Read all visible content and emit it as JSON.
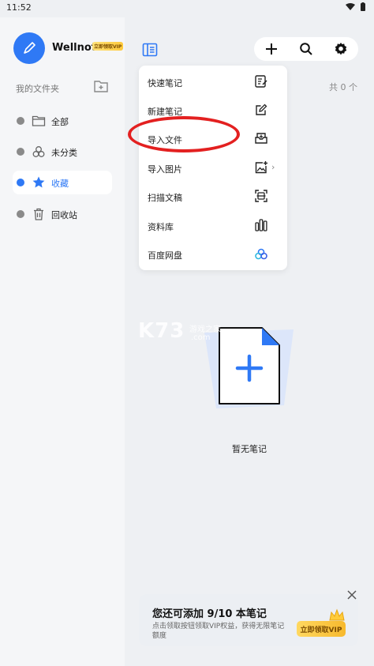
{
  "status": {
    "time": "11:52"
  },
  "sidebar": {
    "app_name": "Wellnote",
    "vip_tag": "立即领取VIP",
    "folders_title": "我的文件夹",
    "items": [
      {
        "label": "全部",
        "icon": "folder-icon",
        "active": false
      },
      {
        "label": "未分类",
        "icon": "circles-icon",
        "active": false
      },
      {
        "label": "收藏",
        "icon": "star-icon",
        "active": true
      },
      {
        "label": "回收站",
        "icon": "trash-icon",
        "active": false
      }
    ]
  },
  "main": {
    "count": "共 0 个",
    "empty_text": "暂无笔记"
  },
  "menu": {
    "items": [
      {
        "label": "快速笔记",
        "icon": "quick-note-icon"
      },
      {
        "label": "新建笔记",
        "icon": "edit-note-icon"
      },
      {
        "label": "导入文件",
        "icon": "import-file-icon"
      },
      {
        "label": "导入图片",
        "icon": "image-plus-icon"
      },
      {
        "label": "扫描文稿",
        "icon": "scan-icon"
      },
      {
        "label": "资料库",
        "icon": "library-icon"
      },
      {
        "label": "百度网盘",
        "icon": "baidu-cloud-icon"
      }
    ]
  },
  "watermark": {
    "main": "K73",
    "sub": "游戏之家",
    "dom": ".com"
  },
  "promo": {
    "title": "您还可添加 9/10 本笔记",
    "desc": "点击领取按钮领取VIP权益，获得无限笔记额度",
    "button": "立即领取VIP"
  },
  "colors": {
    "accent": "#2f79f5",
    "highlight": "#e32020"
  }
}
